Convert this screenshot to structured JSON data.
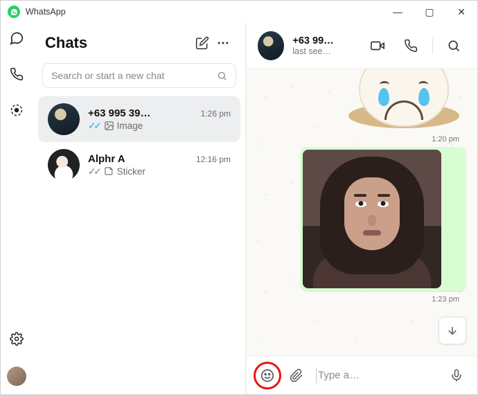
{
  "app": {
    "title": "WhatsApp"
  },
  "window_controls": {
    "min": "—",
    "max": "▢",
    "close": "✕"
  },
  "rail": {
    "chats": "chats-icon",
    "calls": "calls-icon",
    "status": "status-icon",
    "settings": "settings-icon"
  },
  "chats": {
    "title": "Chats",
    "search_placeholder": "Search or start a new chat",
    "items": [
      {
        "name": "+63 995 39…",
        "time": "1:26 pm",
        "check_style": "blue",
        "type_icon": "image-icon",
        "type_label": "Image",
        "active": true
      },
      {
        "name": "Alphr A",
        "time": "12:16 pm",
        "check_style": "gray",
        "type_icon": "sticker-icon",
        "type_label": "Sticker",
        "active": false
      }
    ]
  },
  "conversation": {
    "title": "+63 99…",
    "subtitle": "last see…",
    "messages": [
      {
        "kind": "sticker",
        "desc": "crying-face-melting-sticker",
        "time": "1:20 pm"
      },
      {
        "kind": "gif",
        "desc": "person-eye-roll-gif",
        "time": "1:23 pm"
      }
    ]
  },
  "composer": {
    "placeholder": "Type a…",
    "highlight_emoji": true
  }
}
